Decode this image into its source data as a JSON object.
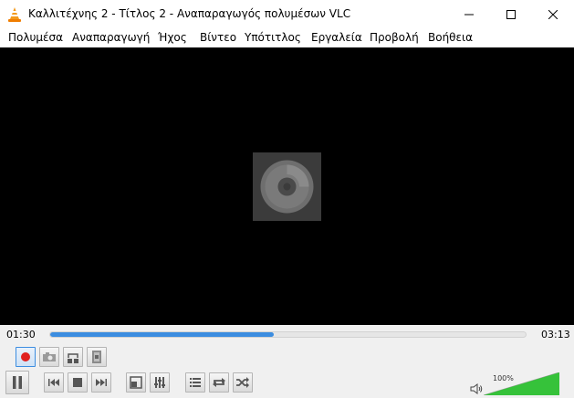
{
  "window": {
    "title": "Καλλιτέχνης 2 - Τίτλος 2 - Αναπαραγωγός πολυμέσων VLC"
  },
  "menu": [
    {
      "label": "Πολυμέσα"
    },
    {
      "label": "Αναπαραγωγή"
    },
    {
      "label": "Ήχος"
    },
    {
      "label": "Βίντεο"
    },
    {
      "label": "Υπότιτλος"
    },
    {
      "label": "Εργαλεία"
    },
    {
      "label": "Προβολή"
    },
    {
      "label": "Βοήθεια"
    }
  ],
  "player": {
    "time_elapsed": "01:30",
    "time_total": "03:13",
    "progress_fraction": 0.47,
    "volume_label": "100%",
    "volume_fraction": 1.0
  },
  "colors": {
    "accent": "#3c8de0",
    "record": "#e02020",
    "volume": "#36c23a"
  },
  "icons": {
    "app": "vlc-cone-icon",
    "artwork": "disc-icon",
    "record": "record-icon",
    "snapshot": "snapshot-icon",
    "loop_ab": "loop-ab-icon",
    "frame_step": "frame-step-icon",
    "pause": "pause-icon",
    "previous": "previous-icon",
    "stop": "stop-icon",
    "next": "next-icon",
    "fullscreen": "fullscreen-icon",
    "extended_settings": "equalizer-icon",
    "playlist": "playlist-icon",
    "loop": "loop-icon",
    "random": "shuffle-icon",
    "volume": "speaker-icon"
  }
}
